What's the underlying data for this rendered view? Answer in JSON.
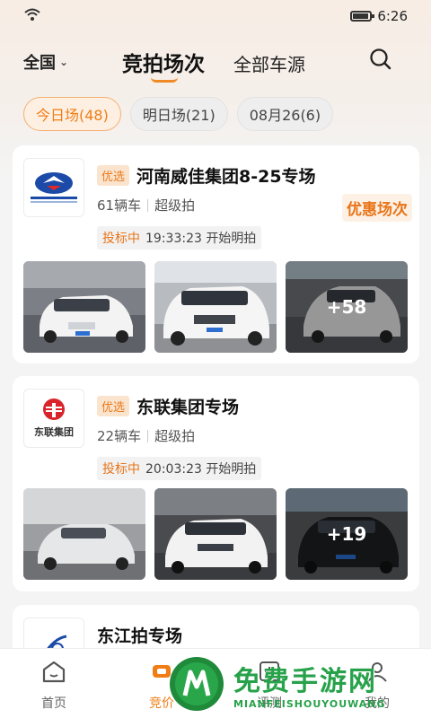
{
  "status_bar": {
    "time": "6:26"
  },
  "header": {
    "region": "全国",
    "tab_active": "竞拍场次",
    "tab_other": "全部车源"
  },
  "date_chips": [
    {
      "label": "今日场(48)",
      "active": true
    },
    {
      "label": "明日场(21)",
      "active": false
    },
    {
      "label": "08月26(6)",
      "active": false
    }
  ],
  "cards": [
    {
      "tag": "优选",
      "title": "河南威佳集团8-25专场",
      "count": "61辆车",
      "type": "超级拍",
      "promo": "优惠场次",
      "bid_status": "投标中",
      "schedule": "19:33:23 开始明拍",
      "more": "+58"
    },
    {
      "tag": "优选",
      "title": "东联集团专场",
      "logo_text": "东联集团",
      "count": "22辆车",
      "type": "超级拍",
      "bid_status": "投标中",
      "schedule": "20:03:23 开始明拍",
      "more": "+19"
    },
    {
      "title": "东江拍专场"
    }
  ],
  "bottom_nav": [
    {
      "label": "首页",
      "icon": "home-icon"
    },
    {
      "label": "竞价",
      "icon": "auction-icon"
    },
    {
      "label": "评测",
      "icon": "assess-icon"
    },
    {
      "label": "我的",
      "icon": "profile-icon"
    }
  ],
  "watermark": {
    "cn": "免费手游网",
    "en": "MIANFEISHOUYOUWANG"
  },
  "colors": {
    "accent": "#f07d16",
    "watermark": "#27a24a"
  }
}
